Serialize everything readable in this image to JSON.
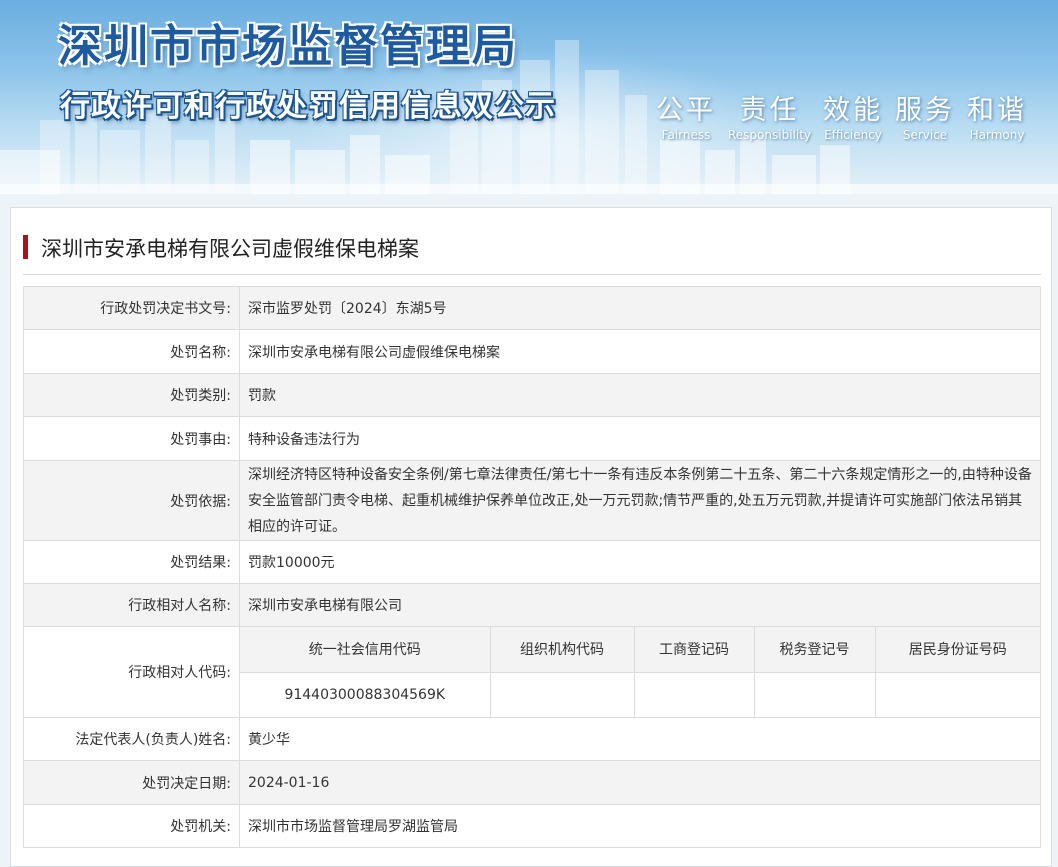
{
  "header": {
    "agency": "深圳市市场监督管理局",
    "subtitle": "行政许可和行政处罚信用信息双公示",
    "values": [
      {
        "cn": "公平",
        "en": "Fairness"
      },
      {
        "cn": "责任",
        "en": "Responsibility"
      },
      {
        "cn": "效能",
        "en": "Efficiency"
      },
      {
        "cn": "服务",
        "en": "Service"
      },
      {
        "cn": "和谐",
        "en": "Harmony"
      }
    ],
    "accent_color": "#1e5aa0"
  },
  "case": {
    "title": "深圳市安承电梯有限公司虚假维保电梯案",
    "title_bar_color": "#a2141e"
  },
  "rows": {
    "decision_no": {
      "label": "行政处罚决定书文号:",
      "value": "深市监罗处罚〔2024〕东湖5号"
    },
    "penalty_name": {
      "label": "处罚名称:",
      "value": "深圳市安承电梯有限公司虚假维保电梯案"
    },
    "penalty_type": {
      "label": "处罚类别:",
      "value": "罚款"
    },
    "penalty_reason": {
      "label": "处罚事由:",
      "value": "特种设备违法行为"
    },
    "penalty_basis": {
      "label": "处罚依据:",
      "value": "深圳经济特区特种设备安全条例/第七章法律责任/第七十一条有违反本条例第二十五条、第二十六条规定情形之一的,由特种设备安全监管部门责令电梯、起重机械维护保养单位改正,处一万元罚款;情节严重的,处五万元罚款,并提请许可实施部门依法吊销其相应的许可证。"
    },
    "penalty_result": {
      "label": "处罚结果:",
      "value": "罚款10000元"
    },
    "party_name": {
      "label": "行政相对人名称:",
      "value": "深圳市安承电梯有限公司"
    },
    "party_code": {
      "label": "行政相对人代码:",
      "headers": [
        "统一社会信用代码",
        "组织机构代码",
        "工商登记码",
        "税务登记号",
        "居民身份证号码"
      ],
      "values": [
        "91440300088304569K",
        "",
        "",
        "",
        ""
      ]
    },
    "legal_rep": {
      "label": "法定代表人(负责人)姓名:",
      "value": "黄少华"
    },
    "decision_date": {
      "label": "处罚决定日期:",
      "value": "2024-01-16"
    },
    "authority": {
      "label": "处罚机关:",
      "value": "深圳市市场监督管理局罗湖监管局"
    }
  }
}
